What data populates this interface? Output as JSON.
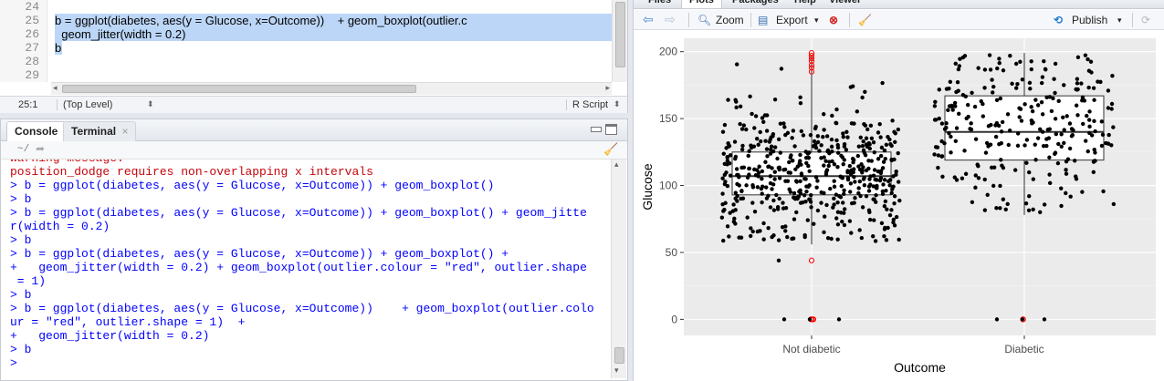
{
  "editor": {
    "line_numbers": [
      "24",
      "25",
      "26",
      "27",
      "28",
      "29"
    ],
    "code_lines": [
      "",
      "b = ggplot(diabetes, aes(y = Glucose, x=Outcome))    + geom_boxplot(outlier.c",
      "  geom_jitter(width = 0.2)",
      "b",
      "",
      ""
    ],
    "status_position": "25:1",
    "status_scope": "(Top Level)",
    "status_filetype": "R Script"
  },
  "console": {
    "tab_console": "Console",
    "tab_terminal": "Terminal",
    "path": "~/",
    "lines": [
      {
        "text": "Warning message:",
        "kind": "err"
      },
      {
        "text": "position_dodge requires non-overlapping x intervals",
        "kind": "err"
      },
      {
        "text": "> b = ggplot(diabetes, aes(y = Glucose, x=Outcome)) + geom_boxplot()",
        "kind": "cmd"
      },
      {
        "text": "> b",
        "kind": "cmd"
      },
      {
        "text": "> b = ggplot(diabetes, aes(y = Glucose, x=Outcome)) + geom_boxplot() + geom_jitte",
        "kind": "cmd"
      },
      {
        "text": "r(width = 0.2)",
        "kind": "cmd"
      },
      {
        "text": "> b",
        "kind": "cmd"
      },
      {
        "text": "> b = ggplot(diabetes, aes(y = Glucose, x=Outcome)) + geom_boxplot() +",
        "kind": "cmd"
      },
      {
        "text": "+   geom_jitter(width = 0.2) + geom_boxplot(outlier.colour = \"red\", outlier.shape",
        "kind": "cmd"
      },
      {
        "text": " = 1)",
        "kind": "cmd"
      },
      {
        "text": "> b",
        "kind": "cmd"
      },
      {
        "text": "> b = ggplot(diabetes, aes(y = Glucose, x=Outcome))    + geom_boxplot(outlier.colo",
        "kind": "cmd"
      },
      {
        "text": "ur = \"red\", outlier.shape = 1)  +",
        "kind": "cmd"
      },
      {
        "text": "+   geom_jitter(width = 0.2)",
        "kind": "cmd"
      },
      {
        "text": "> b",
        "kind": "cmd"
      },
      {
        "text": "> ",
        "kind": "cmd"
      }
    ]
  },
  "plot_pane": {
    "tabs": [
      "Files",
      "Plots",
      "Packages",
      "Help",
      "Viewer"
    ],
    "zoom_label": "Zoom",
    "export_label": "Export",
    "publish_label": "Publish"
  },
  "chart_data": {
    "type": "boxplot",
    "xlabel": "Outcome",
    "ylabel": "Glucose",
    "categories": [
      "Not diabetic",
      "Diabetic"
    ],
    "ylim": [
      -12,
      210
    ],
    "yticks": [
      0,
      50,
      100,
      150,
      200
    ],
    "boxes": [
      {
        "category": "Not diabetic",
        "q1": 93,
        "median": 107,
        "q3": 125,
        "whisker_low": 56,
        "whisker_high": 197,
        "outliers": [
          0,
          0,
          0,
          0,
          44,
          199,
          197,
          195,
          193,
          190,
          188,
          185
        ]
      },
      {
        "category": "Diabetic",
        "q1": 119,
        "median": 140,
        "q3": 167,
        "whisker_low": 78,
        "whisker_high": 199,
        "outliers": [
          0,
          0
        ]
      }
    ],
    "colors": {
      "panel": "#ebebeb",
      "grid": "#ffffff",
      "box_fill": "#ffffff",
      "box_line": "#333333",
      "jitter": "#000000",
      "outlier": "#ff0000"
    }
  }
}
